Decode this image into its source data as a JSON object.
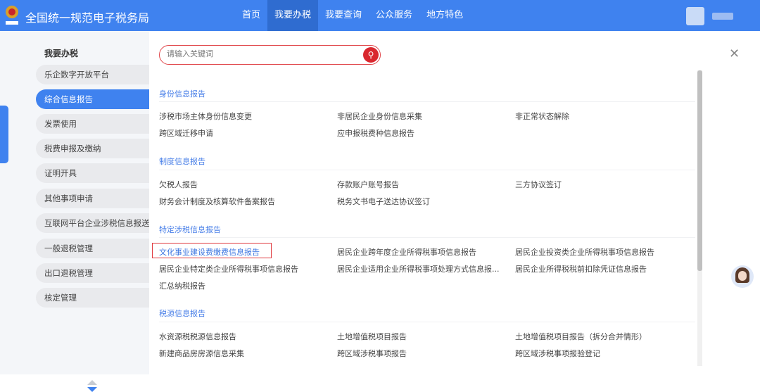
{
  "header": {
    "title": "全国统一规范电子税务局",
    "nav": [
      "首页",
      "我要办税",
      "我要查询",
      "公众服务",
      "地方特色"
    ],
    "active_nav": 1
  },
  "sidebar": {
    "title": "我要办税",
    "items": [
      "乐企数字开放平台",
      "综合信息报告",
      "发票使用",
      "税费申报及缴纳",
      "证明开具",
      "其他事项申请",
      "互联网平台企业涉税信息报送",
      "一般退税管理",
      "出口退税管理",
      "核定管理"
    ],
    "active": 1
  },
  "search": {
    "placeholder": "请输入关键词"
  },
  "sections": [
    {
      "title": "身份信息报告",
      "items": [
        "涉税市场主体身份信息变更",
        "非居民企业身份信息采集",
        "非正常状态解除",
        "跨区域迁移申请",
        "应申报税费种信息报告"
      ]
    },
    {
      "title": "制度信息报告",
      "items": [
        "欠税人报告",
        "存款账户账号报告",
        "三方协议签订",
        "财务会计制度及核算软件备案报告",
        "税务文书电子送达协议签订"
      ]
    },
    {
      "title": "特定涉税信息报告",
      "items": [
        "文化事业建设费缴费信息报告",
        "居民企业跨年度企业所得税事项信息报告",
        "居民企业投资类企业所得税事项信息报告",
        "居民企业特定类企业所得税事项信息报告",
        "居民企业适用企业所得税事项处理方式信息报...",
        "居民企业所得税税前扣除凭证信息报告",
        "汇总纳税报告"
      ]
    },
    {
      "title": "税源信息报告",
      "items": [
        "水资源税税源信息报告",
        "土地增值税项目报告",
        "土地增值税项目报告（拆分合并情形）",
        "新建商品房房源信息采集",
        "跨区域涉税事项报告",
        "跨区域涉税事项报验登记"
      ]
    }
  ],
  "highlighted_item": "文化事业建设费缴费信息报告",
  "colors": {
    "brand": "#3f82ef",
    "highlight": "#e0393e"
  }
}
